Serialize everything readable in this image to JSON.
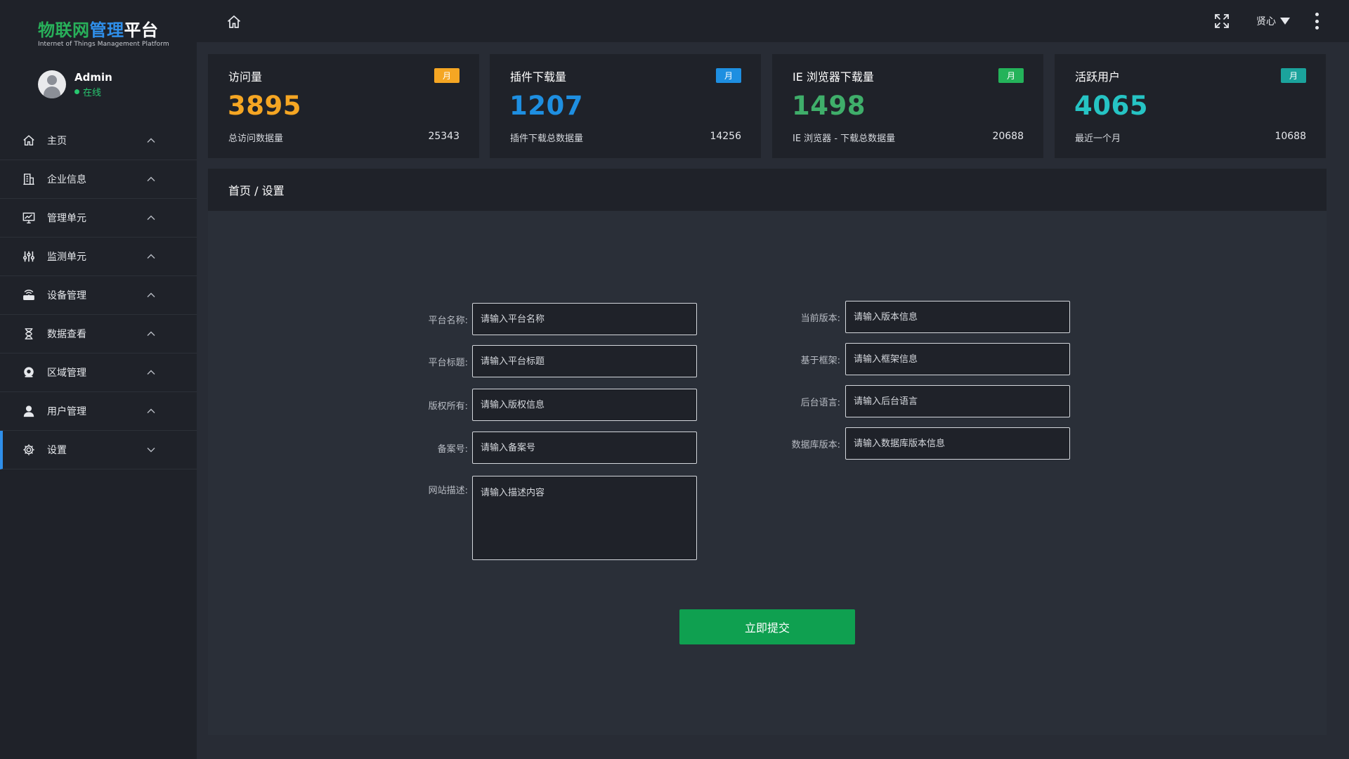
{
  "brand": {
    "title_part1": "物联网",
    "title_part2": "管理",
    "title_part3": "平台",
    "subtitle": "Internet of Things Management Platform"
  },
  "user": {
    "name": "Admin",
    "status": "在线",
    "menu_label": "贤心"
  },
  "sidebar": {
    "items": [
      {
        "label": "主页",
        "icon": "home-icon"
      },
      {
        "label": "企业信息",
        "icon": "building-icon"
      },
      {
        "label": "管理单元",
        "icon": "monitor-chart-icon"
      },
      {
        "label": "监测单元",
        "icon": "sliders-icon"
      },
      {
        "label": "设备管理",
        "icon": "router-icon"
      },
      {
        "label": "数据查看",
        "icon": "hourglass-icon"
      },
      {
        "label": "区域管理",
        "icon": "location-icon"
      },
      {
        "label": "用户管理",
        "icon": "user-icon"
      },
      {
        "label": "设置",
        "icon": "gear-icon",
        "active": true
      }
    ]
  },
  "cards": [
    {
      "title": "访问量",
      "badge": "月",
      "value": "3895",
      "sub": "总访问数据量",
      "total": "25343",
      "color": "#f5a623",
      "badge_color": "#f5a623"
    },
    {
      "title": "插件下载量",
      "badge": "月",
      "value": "1207",
      "sub": "插件下载总数据量",
      "total": "14256",
      "color": "#1e8fe1",
      "badge_color": "#1e8fe1"
    },
    {
      "title": "IE 浏览器下载量",
      "badge": "月",
      "value": "1498",
      "sub": "IE 浏览器 - 下载总数据量",
      "total": "20688",
      "color": "#3fae6a",
      "badge_color": "#24b35a"
    },
    {
      "title": "活跃用户",
      "badge": "月",
      "value": "4065",
      "sub": "最近一个月",
      "total": "10688",
      "color": "#26c4c4",
      "badge_color": "#1ba39c"
    }
  ],
  "breadcrumb": "首页 / 设置",
  "form": {
    "left": [
      {
        "label": "平台名称:",
        "placeholder": "请输入平台名称"
      },
      {
        "label": "平台标题:",
        "placeholder": "请输入平台标题"
      },
      {
        "label": "版权所有:",
        "placeholder": "请输入版权信息"
      },
      {
        "label": "备案号:",
        "placeholder": "请输入备案号"
      }
    ],
    "description": {
      "label": "网站描述:",
      "placeholder": "请输入描述内容"
    },
    "right": [
      {
        "label": "当前版本:",
        "placeholder": "请输入版本信息"
      },
      {
        "label": "基于框架:",
        "placeholder": "请输入框架信息"
      },
      {
        "label": "后台语言:",
        "placeholder": "请输入后台语言"
      },
      {
        "label": "数据库版本:",
        "placeholder": "请输入数据库版本信息"
      }
    ],
    "submit_label": "立即提交"
  }
}
